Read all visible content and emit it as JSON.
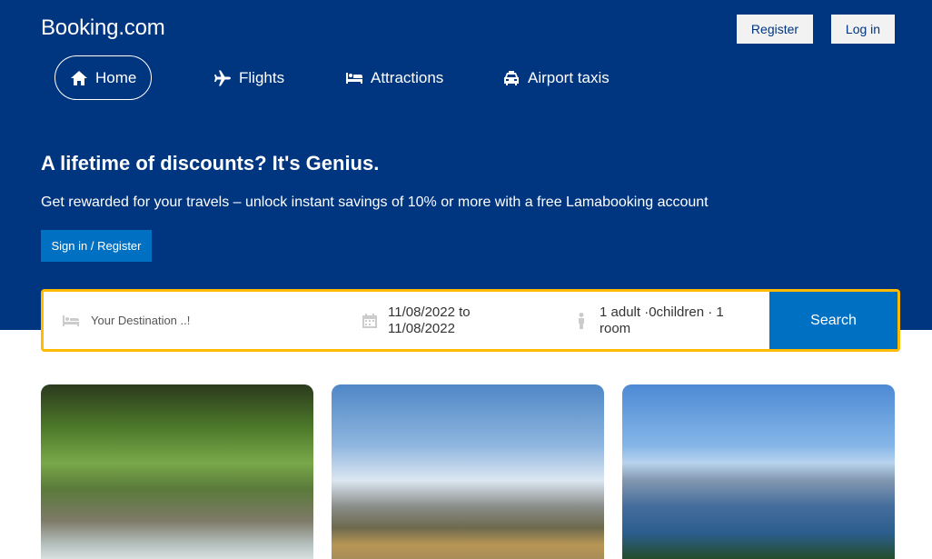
{
  "brand": {
    "name": "Booking.com"
  },
  "auth": {
    "register_label": "Register",
    "login_label": "Log in"
  },
  "nav": {
    "items": [
      {
        "label": "Home",
        "icon": "home-icon",
        "active": true
      },
      {
        "label": "Flights",
        "icon": "plane-icon",
        "active": false
      },
      {
        "label": "Attractions",
        "icon": "bed-icon",
        "active": false
      },
      {
        "label": "Airport taxis",
        "icon": "taxi-icon",
        "active": false
      }
    ]
  },
  "hero": {
    "title": "A lifetime of discounts? It's Genius.",
    "subtitle": "Get rewarded for your travels – unlock instant savings of 10% or more with a free Lamabooking account",
    "cta_label": "Sign in / Register"
  },
  "search": {
    "destination_placeholder": "Your Destination ..!",
    "dates": "11/08/2022 to 11/08/2022",
    "guests": "1 adult ·0children · 1 room",
    "button_label": "Search"
  },
  "colors": {
    "primary": "#003580",
    "accent": "#0071c2",
    "highlight": "#febb02"
  }
}
